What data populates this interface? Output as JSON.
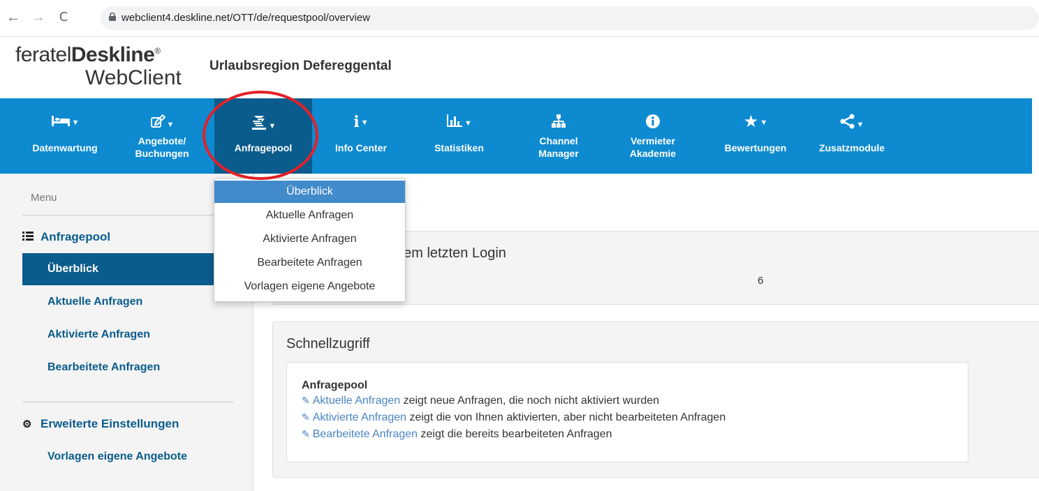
{
  "browser": {
    "back": "←",
    "forward": "→",
    "reload": "C",
    "url": "webclient4.deskline.net/OTT/de/requestpool/overview"
  },
  "header": {
    "logo_prefix": "feratel",
    "logo_brand": "Deskline",
    "logo_reg": "®",
    "logo_sub": "WebClient",
    "region": "Urlaubsregion Defereggental"
  },
  "nav": {
    "items": [
      {
        "label": "Datenwartung",
        "icon": "bed-icon"
      },
      {
        "label1": "Angebote/",
        "label2": "Buchungen",
        "icon": "offers-icon"
      },
      {
        "label": "Anfragepool",
        "icon": "request-pool-icon"
      },
      {
        "label": "Info Center",
        "icon": "info-letter-icon"
      },
      {
        "label": "Statistiken",
        "icon": "chart-icon"
      },
      {
        "label1": "Channel",
        "label2": "Manager",
        "icon": "sitemap-icon"
      },
      {
        "label1": "Vermieter",
        "label2": "Akademie",
        "icon": "info-circle-icon"
      },
      {
        "label": "Bewertungen",
        "icon": "star-icon"
      },
      {
        "label": "Zusatzmodule",
        "icon": "share-icon"
      }
    ],
    "accent": "#0d8ad0",
    "active_bg": "#0a5c8c",
    "highlight_color": "#e32128"
  },
  "dropdown": {
    "items": [
      "Überblick",
      "Aktuelle Anfragen",
      "Aktivierte Anfragen",
      "Bearbeitete Anfragen",
      "Vorlagen eigene Angebote"
    ]
  },
  "sidebar": {
    "menu": "Menu",
    "section1": "Anfragepool",
    "items": [
      "Überblick",
      "Aktuelle Anfragen",
      "Aktivierte Anfragen",
      "Bearbeitete Anfragen"
    ],
    "section2": "Erweiterte Einstellungen",
    "items2": [
      "Vorlagen eigene Angebote"
    ]
  },
  "main": {
    "panel1_title": "dem letzten Login",
    "panel1_count": "6",
    "panel2_title": "Schnellzugriff",
    "quick_head": "Anfragepool",
    "quick": [
      {
        "link": "Aktuelle Anfragen",
        "text": " zeigt neue Anfragen, die noch nicht aktiviert wurden"
      },
      {
        "link": "Aktivierte Anfragen",
        "text": " zeigt die von Ihnen aktivierten, aber nicht bearbeiteten Anfragen"
      },
      {
        "link": "Bearbeitete Anfragen",
        "text": " zeigt die bereits bearbeiteten Anfragen"
      }
    ]
  }
}
